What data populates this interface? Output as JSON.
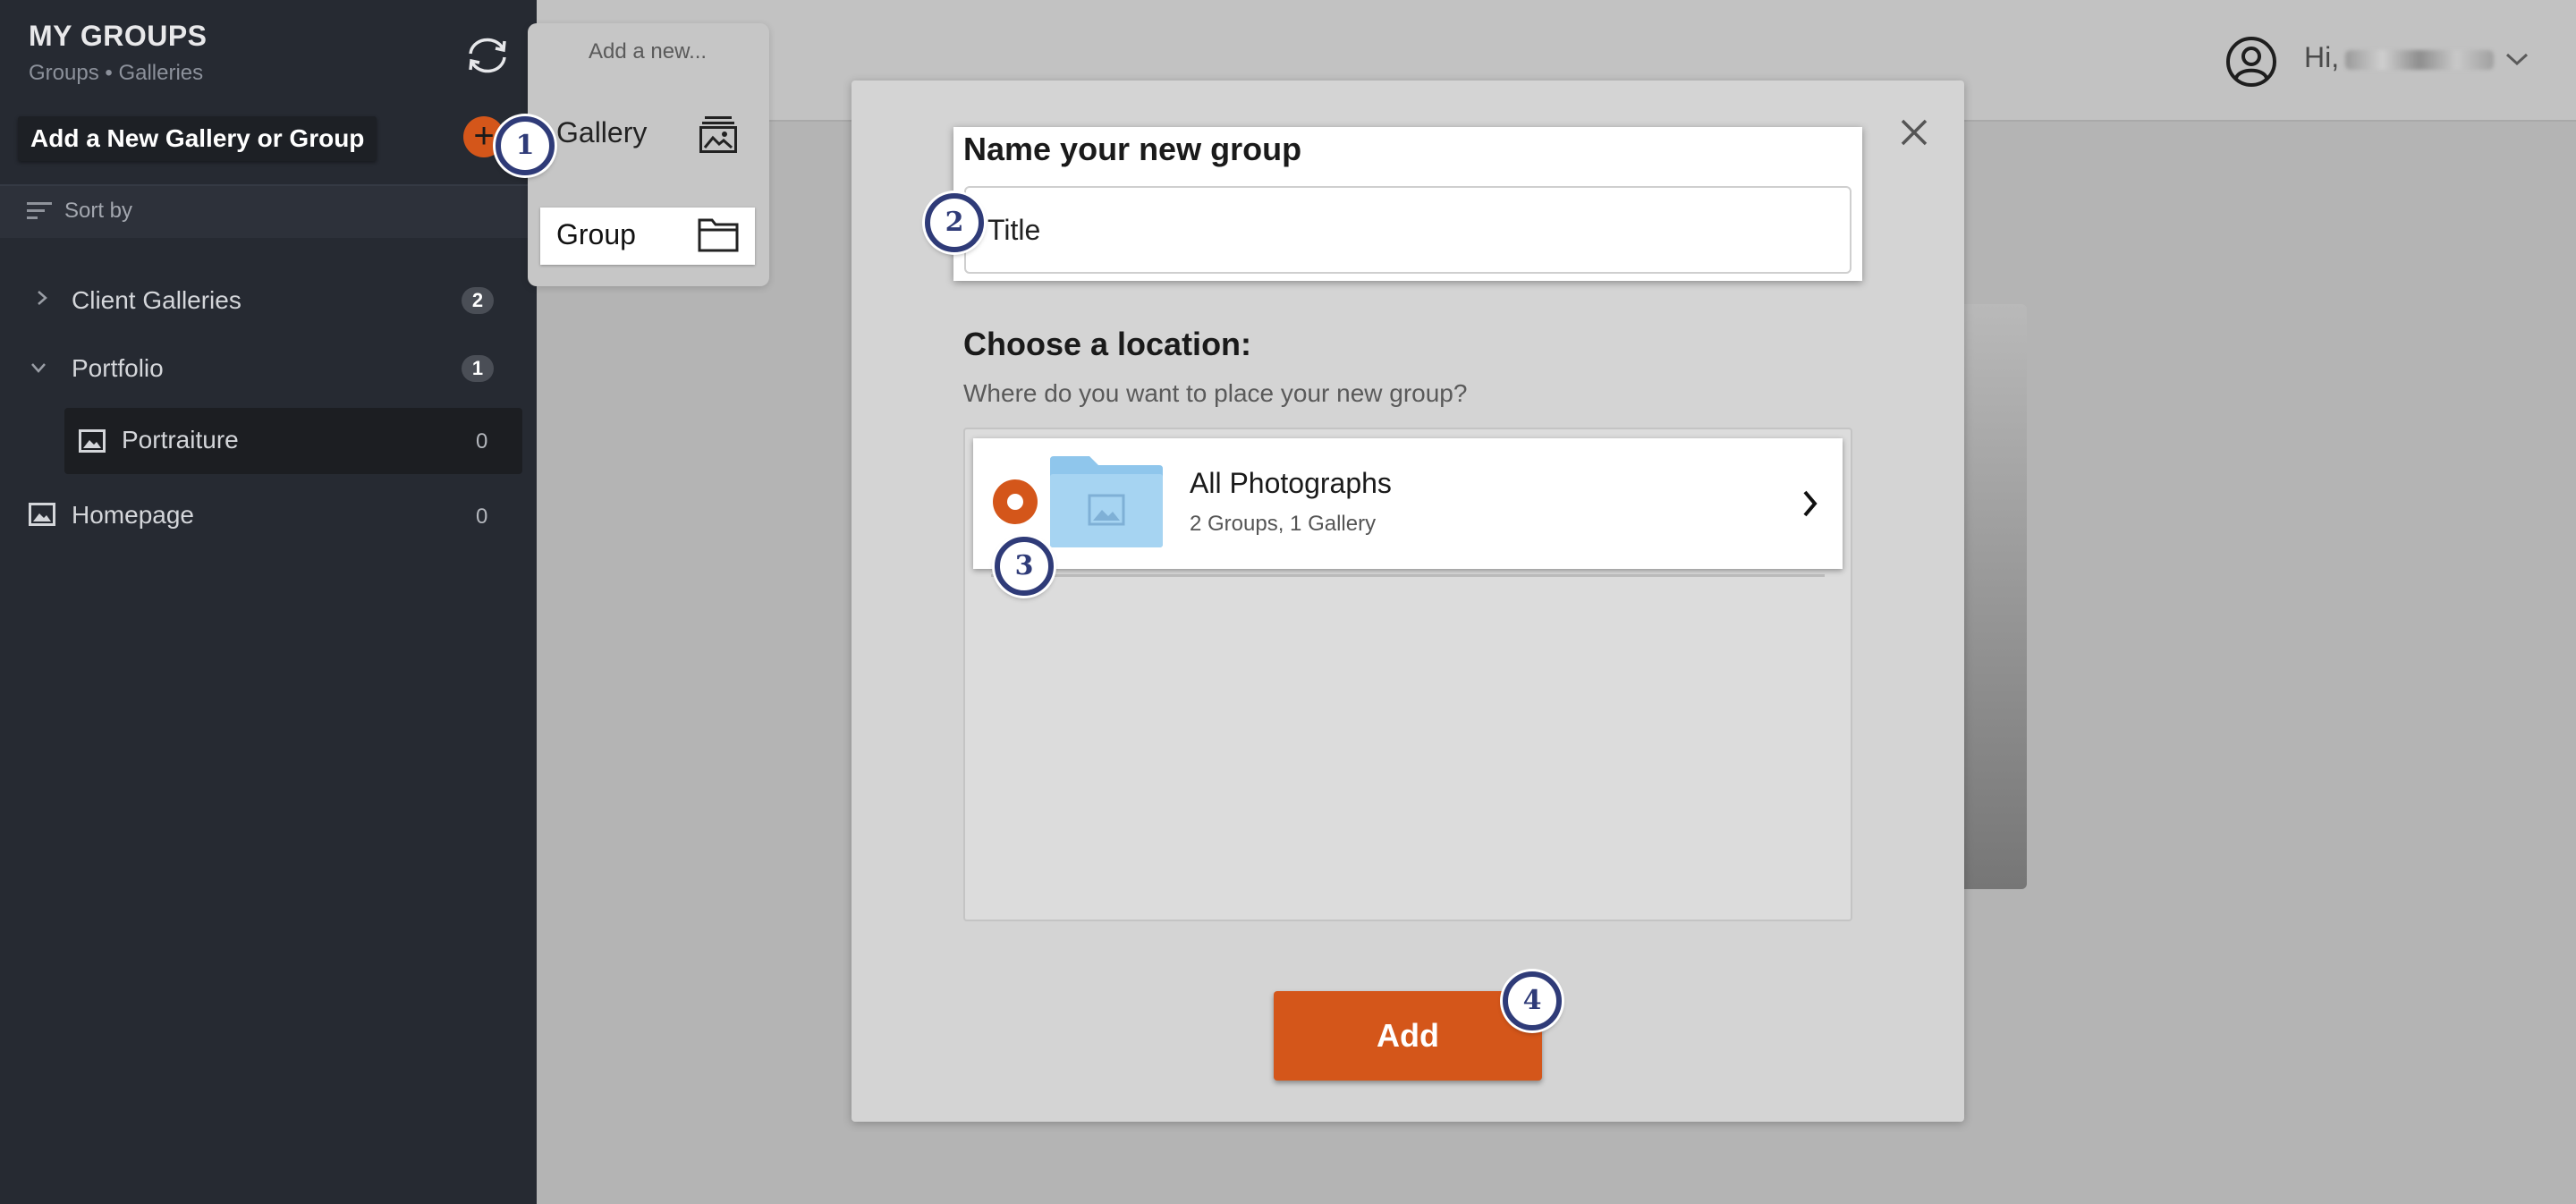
{
  "sidebar": {
    "title": "MY GROUPS",
    "subtitle": "Groups • Galleries",
    "add_tooltip": "Add a New Gallery or Group",
    "add_symbol": "+",
    "sort_label": "Sort by",
    "tree": [
      {
        "label": "Client Galleries",
        "count": "2",
        "expanded": false
      },
      {
        "label": "Portfolio",
        "count": "1",
        "expanded": true,
        "children": [
          {
            "label": "Portraiture",
            "count": "0"
          }
        ]
      },
      {
        "label": "Homepage",
        "count": "0"
      }
    ]
  },
  "header": {
    "greeting": "Hi,"
  },
  "add_menu": {
    "title": "Add a new...",
    "items": [
      {
        "label": "Gallery",
        "icon": "gallery-icon"
      },
      {
        "label": "Group",
        "icon": "folder-icon"
      }
    ]
  },
  "modal": {
    "heading": "Name your new group",
    "title_placeholder": "Title",
    "location_heading": "Choose a location:",
    "location_prompt": "Where do you want to place your new group?",
    "location": {
      "name": "All Photographs",
      "meta": "2 Groups, 1 Gallery",
      "selected": true
    },
    "submit_label": "Add"
  },
  "steps": [
    "1",
    "2",
    "3",
    "4"
  ],
  "colors": {
    "accent": "#d4561a",
    "sidebar_bg": "#262a32",
    "step_ring": "#2f3b78",
    "folder_blue": "#9ccff0"
  }
}
